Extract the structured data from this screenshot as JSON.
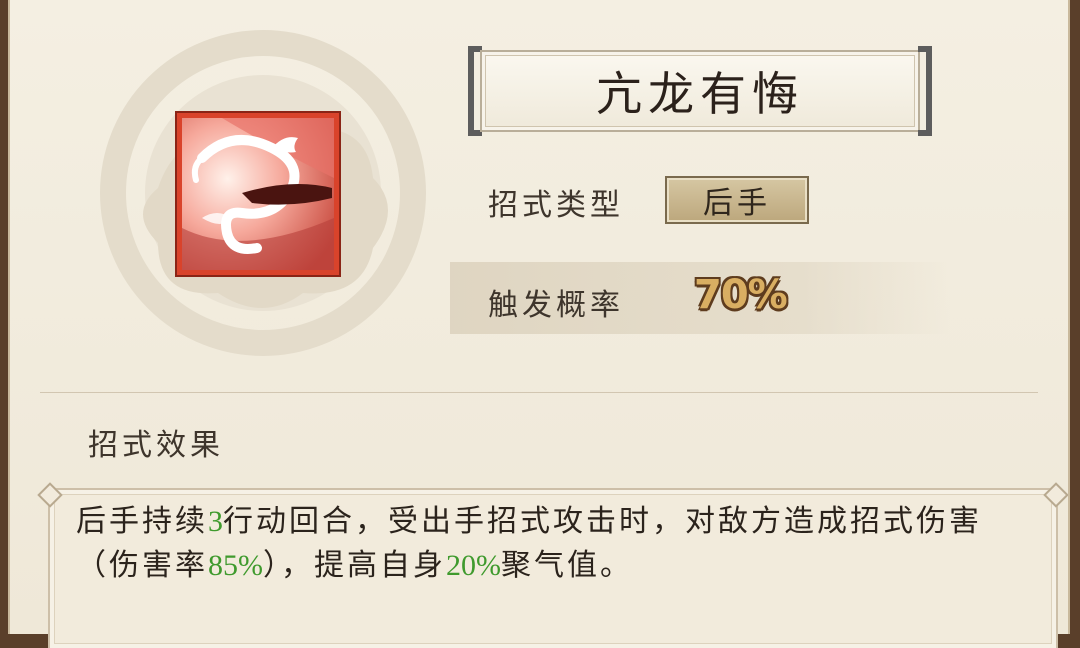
{
  "skill": {
    "name": "亢龙有悔",
    "icon": "dragon-skill-icon"
  },
  "type": {
    "label": "招式类型",
    "value": "后手"
  },
  "chance": {
    "label": "触发概率",
    "value": "70%"
  },
  "effect": {
    "title": "招式效果",
    "text_parts": [
      {
        "text": "后手持续",
        "highlight": false
      },
      {
        "text": "3",
        "highlight": true
      },
      {
        "text": "行动回合，受出手招式攻击时，对敌方造成招式伤害（伤害率",
        "highlight": false
      },
      {
        "text": "85%",
        "highlight": true
      },
      {
        "text": "），提高自身",
        "highlight": false
      },
      {
        "text": "20%",
        "highlight": true
      },
      {
        "text": "聚气值。",
        "highlight": false
      }
    ]
  },
  "colors": {
    "highlight": "#3f9a2d",
    "icon_border": "#d9432b",
    "chance_gold": "#d9ae62"
  }
}
